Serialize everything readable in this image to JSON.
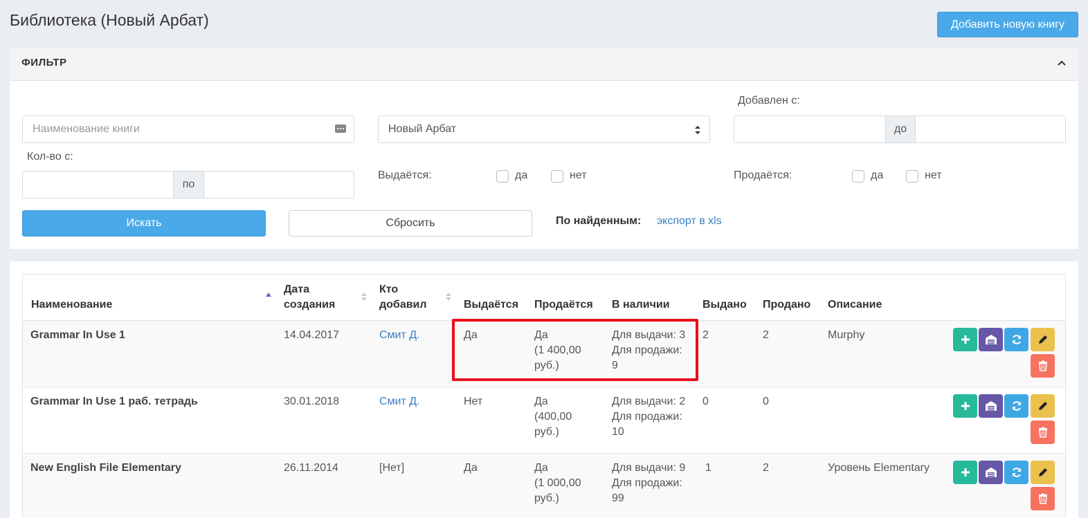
{
  "page": {
    "title": "Библиотека (Новый Арбат)",
    "add_button": "Добавить новую книгу"
  },
  "filter": {
    "title": "ФИЛЬТР",
    "book_name_placeholder": "Наименование книги",
    "branch_selected": "Новый Арбат",
    "added_from_label": "Добавлен с:",
    "date_to_addon": "до",
    "qty_from_label": "Кол-во с:",
    "qty_to_addon": "по",
    "issued_label": "Выдаётся:",
    "issued_yes": "да",
    "issued_no": "нет",
    "sold_label": "Продаётся:",
    "sold_yes": "да",
    "sold_no": "нет",
    "search_button": "Искать",
    "reset_button": "Сбросить",
    "found_label": "По найденным:",
    "export_link": "экспорт в xls"
  },
  "table": {
    "columns": {
      "name": "Наименование",
      "created_line1": "Дата",
      "created_line2": "создания",
      "added_by_line1": "Кто",
      "added_by_line2": "добавил",
      "issued": "Выдаётся",
      "sold": "Продаётся",
      "in_stock": "В наличии",
      "issued_count": "Выдано",
      "sold_count": "Продано",
      "description": "Описание"
    },
    "rows": [
      {
        "name": "Grammar In Use 1",
        "created": "14.04.2017",
        "added_by": "Смит Д.",
        "issued": "Да",
        "sold_line1": "Да",
        "sold_line2": "(1 400,00",
        "sold_line3": "руб.)",
        "stock_line1": "Для выдачи: 3",
        "stock_line2": "Для продажи:",
        "stock_line3": "9",
        "issued_count": "2",
        "sold_count": "2",
        "description": "Murphy"
      },
      {
        "name": "Grammar In Use 1 раб. тетрадь",
        "created": "30.01.2018",
        "added_by": "Смит Д.",
        "issued": "Нет",
        "sold_line1": "Да",
        "sold_line2": "(400,00",
        "sold_line3": "руб.)",
        "stock_line1": "Для выдачи: 2",
        "stock_line2": "Для продажи:",
        "stock_line3": "10",
        "issued_count": "0",
        "sold_count": "0",
        "description": ""
      },
      {
        "name": "New English File Elementary",
        "created": "26.11.2014",
        "added_by": "[Нет]",
        "issued": "Да",
        "sold_line1": "Да",
        "sold_line2": "(1 000,00",
        "sold_line3": "руб.)",
        "stock_line1": "Для выдачи: 9",
        "stock_line2": "Для продажи:",
        "stock_line3": "99",
        "issued_count": "1",
        "sold_count": "2",
        "description": "Уровень Elementary"
      }
    ]
  },
  "colors": {
    "primary": "#4aa9e8",
    "green": "#26b99a",
    "purple": "#6657a7",
    "blue": "#3ea8e5",
    "yellow": "#ebc14d",
    "red": "#f7725f",
    "highlight": "#e8101a"
  }
}
